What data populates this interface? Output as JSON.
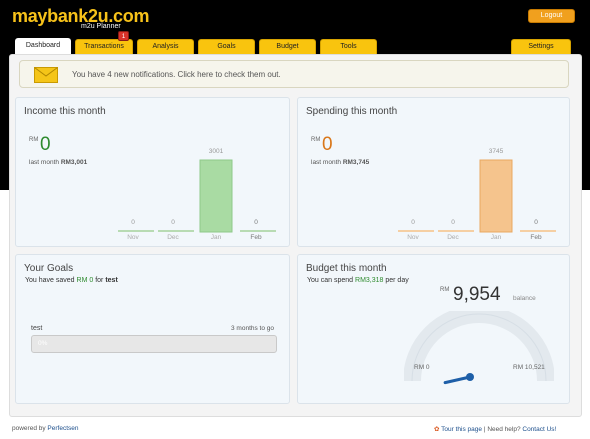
{
  "header": {
    "logo": "maybank2u.com",
    "subtitle": "m2u Planner",
    "logout": "Logout"
  },
  "tabs": [
    {
      "label": "Dashboard"
    },
    {
      "label": "Transactions"
    },
    {
      "label": "Analysis"
    },
    {
      "label": "Goals"
    },
    {
      "label": "Budget"
    },
    {
      "label": "Tools"
    }
  ],
  "settings_tab": "Settings",
  "transactions_badge": "1",
  "notice": {
    "text": "You have 4 new notifications. Click here to check them out."
  },
  "income": {
    "title": "Income this month",
    "rm": "RM",
    "value": "0",
    "last_month_label": "last month",
    "last_month_value": "RM3,001",
    "bars": [
      {
        "month": "Nov",
        "value": "0"
      },
      {
        "month": "Dec",
        "value": "0"
      },
      {
        "month": "Jan",
        "value": "3001"
      },
      {
        "month": "Feb",
        "value": "0"
      }
    ]
  },
  "spending": {
    "title": "Spending this month",
    "rm": "RM",
    "value": "0",
    "last_month_label": "last month",
    "last_month_value": "RM3,745",
    "bars": [
      {
        "month": "Nov",
        "value": "0"
      },
      {
        "month": "Dec",
        "value": "0"
      },
      {
        "month": "Jan",
        "value": "3745"
      },
      {
        "month": "Feb",
        "value": "0"
      }
    ]
  },
  "goals": {
    "title": "Your Goals",
    "line_prefix": "You have saved",
    "saved_amount": "RM 0",
    "line_for": "for",
    "goal_name": "test",
    "item_name": "test",
    "months_to_go": "3 months to go",
    "progress_text": "0%",
    "progress_fraction": 0
  },
  "budget": {
    "title": "Budget this month",
    "line_prefix": "You can spend",
    "per_day_amount": "RM3,318",
    "line_suffix": "per day",
    "rm": "RM",
    "balance_value": "9,954",
    "balance_label": "balance",
    "gauge_min": "RM 0",
    "gauge_max": "RM 10,521",
    "gauge_fraction": 0.05
  },
  "footer": {
    "powered_by": "powered by",
    "brand": "Perfectsen",
    "tour": "Tour this page",
    "need_help": "Need help?",
    "contact": "Contact Us!"
  },
  "colors": {
    "accent": "#f9c40e",
    "income_green": "#2e8b2e",
    "spending_orange": "#d9771a",
    "income_bar": "#a9dba3",
    "spending_bar": "#f5c48d"
  }
}
